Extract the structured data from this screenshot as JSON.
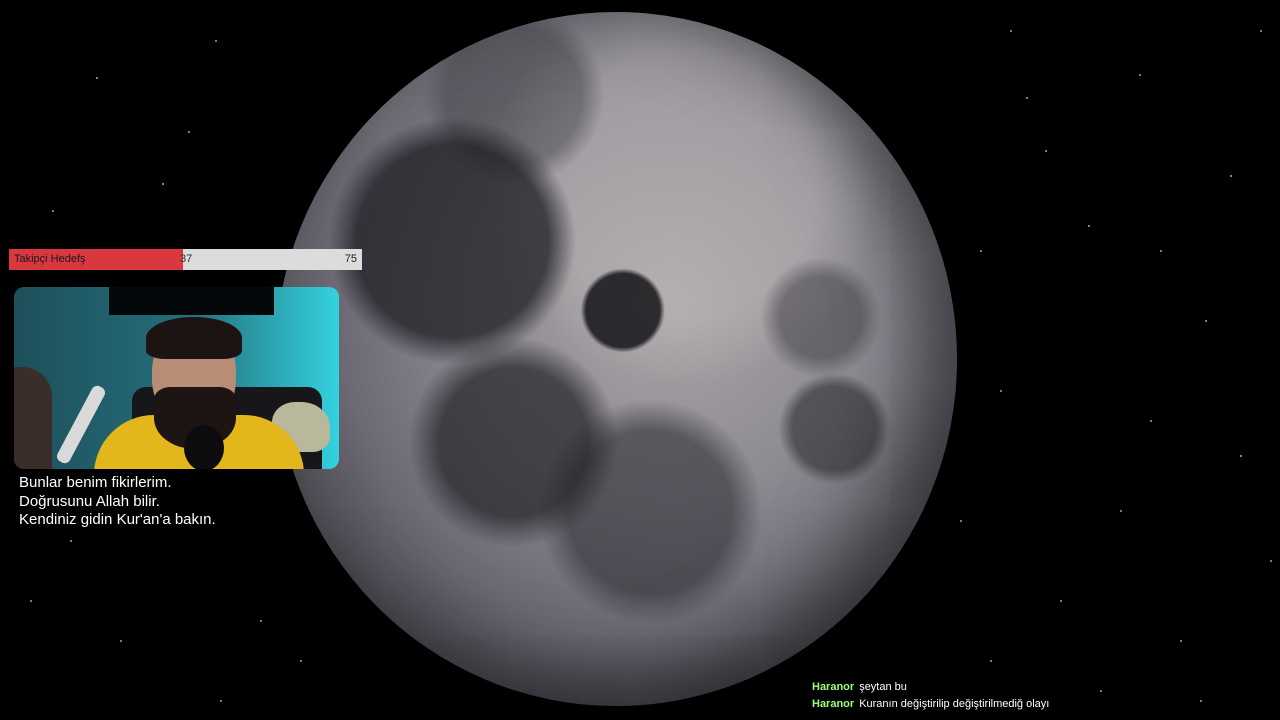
{
  "goal": {
    "title": "Takipçi Hedefş",
    "current": "37",
    "target": "75",
    "progress": 0.493,
    "fill_color": "#d93840",
    "track_color": "#dcdcdc"
  },
  "webcam": {
    "background_color": "#2a8f9b"
  },
  "caption": {
    "lines": [
      "Bunlar benim fikirlerim.",
      "Doğrusunu Allah bilir.",
      "Kendiniz gidin Kur'an'a bakın."
    ]
  },
  "chat": {
    "username_color": "#9bff7a",
    "messages": [
      {
        "user": "Haranor",
        "text": "şeytan bu"
      },
      {
        "user": "Haranor",
        "text": "Kuranın değiştirilip değiştirilmediğ olayı"
      }
    ]
  },
  "scene": {
    "background_color": "#000000",
    "main_image": "moon-image"
  }
}
